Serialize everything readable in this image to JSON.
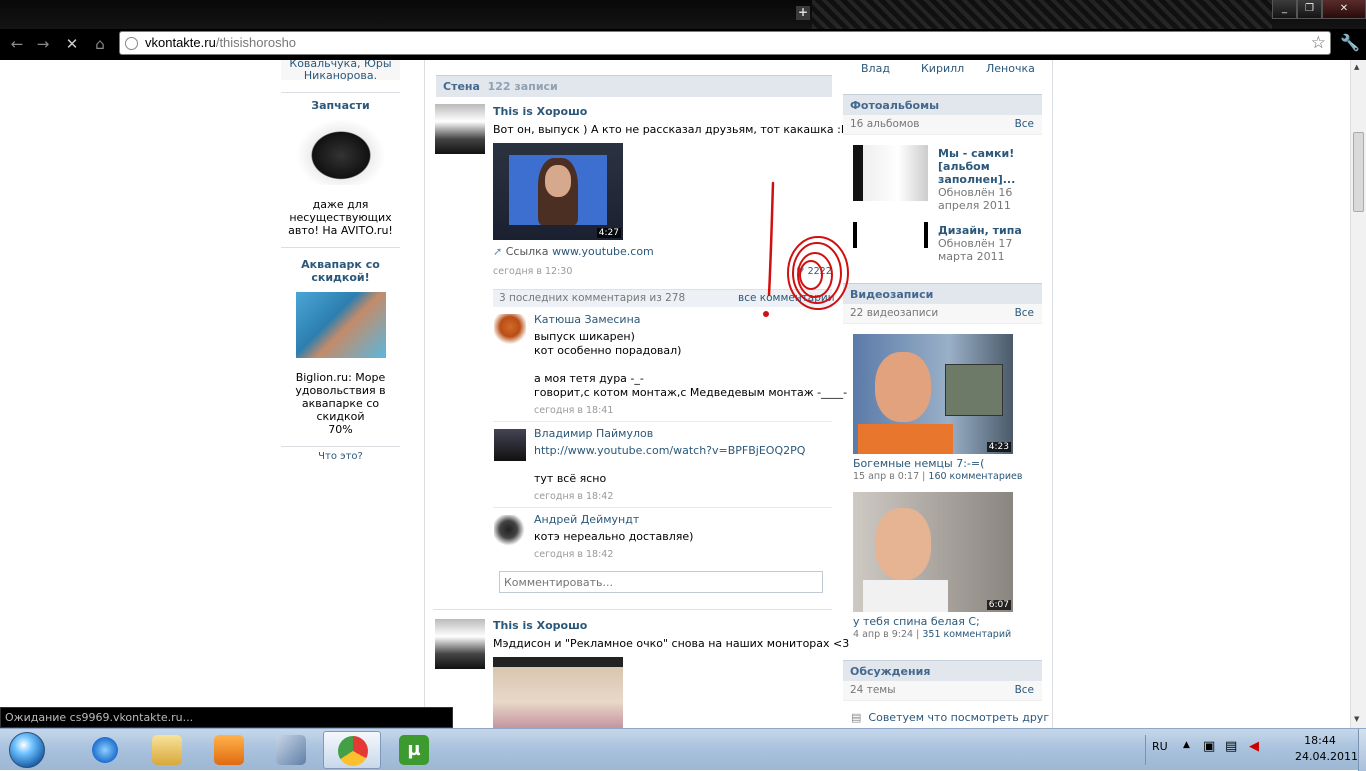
{
  "browser": {
    "url_domain": "vkontakte.ru",
    "url_path": "/thisishorosho",
    "window_controls": [
      "_",
      "❐",
      "✕"
    ],
    "status": "Ожидание cs9969.vkontakte.ru..."
  },
  "left_column": {
    "top_text_1": "Ковальчука, Юры",
    "top_text_2": "Никаноровa.",
    "ad1_title": "Запчасти",
    "ad1_text_1": "даже для",
    "ad1_text_2": "несуществующих",
    "ad1_text_3": "авто! На AVITO.ru!",
    "ad2_title_1": "Аквапарк со",
    "ad2_title_2": "скидкой!",
    "ad2_text_1": "Biglion.ru: Море",
    "ad2_text_2": "удовольствия в",
    "ad2_text_3": "аквапарке со скидкой",
    "ad2_text_4": "70%",
    "what_is_this": "Что это?"
  },
  "wall": {
    "title": "Стена",
    "count": "122 записи",
    "post1": {
      "author": "This is Хорошо",
      "text": "Вот он, выпуск ) А кто не рассказал друзьям, тот какашка :P",
      "video_duration": "4:27",
      "link_label": "Ссылка",
      "link_url": "www.youtube.com",
      "time": "сегодня в 12:30",
      "likes": "2222",
      "comments_summary": "3 последних комментария из 278",
      "all_comments": "все комментарии",
      "comments": [
        {
          "name": "Катюша Замесина",
          "l1": "выпуск шикарен)",
          "l2": "кот особенно порадовал)",
          "l3": "а моя тетя дура -_-",
          "l4": "говорит,с котом монтаж,с Медведевым монтаж -____-",
          "time": "сегодня в 18:41"
        },
        {
          "name": "Владимир Паймулов",
          "l1": "http://www.youtube.com/watch?v=BPFBjEOQ2PQ",
          "l2": "тут всё ясно",
          "time": "сегодня в 18:42"
        },
        {
          "name": "Андрей Деймундт",
          "l1": "котэ нереально доставляе)",
          "time": "сегодня в 18:42"
        }
      ],
      "comment_placeholder": "Комментировать..."
    },
    "post2": {
      "author": "This is Хорошо",
      "text": "Мэддисон и \"Рекламное очко\" снова на наших мониторах <3"
    }
  },
  "right_column": {
    "friends": [
      "Влад",
      "Кирилл",
      "Леночка"
    ],
    "albums": {
      "title": "Фотоальбомы",
      "count": "16 альбомов",
      "all": "Все",
      "items": [
        {
          "name_1": "Мы - самки!",
          "name_2": "[альбом",
          "name_3": "заполнен]...",
          "updated_1": "Обновлён 16",
          "updated_2": "апреля 2011"
        },
        {
          "name_1": "Дизайн, типа",
          "updated_1": "Обновлён 17",
          "updated_2": "марта 2011"
        }
      ]
    },
    "videos": {
      "title": "Видеозаписи",
      "count": "22 видеозаписи",
      "all": "Все",
      "items": [
        {
          "duration": "4:23",
          "title": "Богемные немцы 7:-=(",
          "date": "15 апр в 0:17",
          "comments": "160 комментариев"
        },
        {
          "duration": "6:07",
          "title": "у тебя спина белая С;",
          "date": "4 апр в 9:24",
          "comments": "351 комментарий"
        }
      ]
    },
    "discussions": {
      "title": "Обсуждения",
      "count": "24 темы",
      "all": "Все",
      "first": "Советуем что посмотреть друг"
    }
  },
  "taskbar": {
    "lang": "RU",
    "time": "18:44",
    "date": "24.04.2011"
  }
}
